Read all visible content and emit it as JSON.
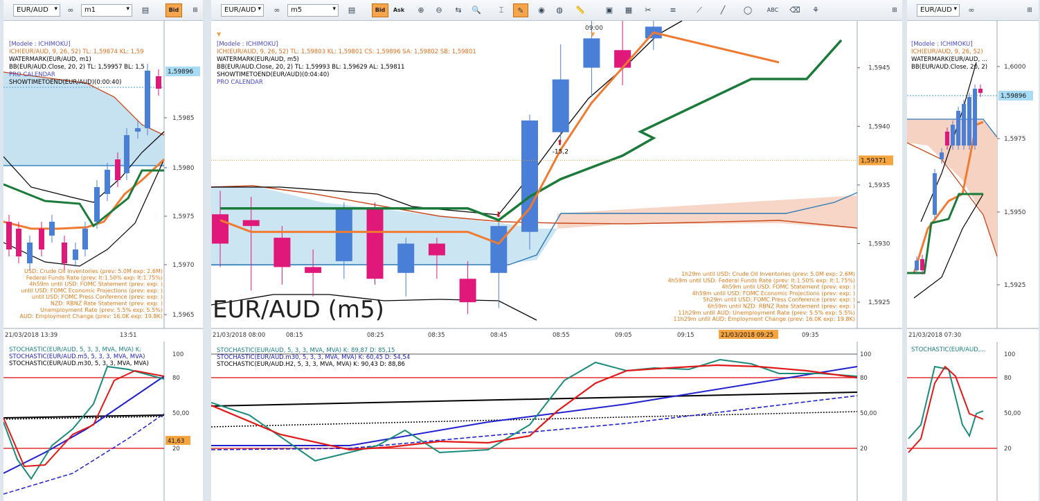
{
  "left": {
    "symbol": "EUR/AUD",
    "timeframe": "m1",
    "bid_label": "Bid",
    "legend": [
      {
        "text": "[Modele : ICHIMOKU]",
        "color": "#4848c8"
      },
      {
        "text": "ICH(EUR/AUD, 9, 26, 52)  TL: 1,59874  KL: 1,59",
        "color": "#e0701e"
      },
      {
        "text": "WATERMARK(EUR/AUD, m1)",
        "color": "#000000"
      },
      {
        "text": "BB(EUR/AUD.Close, 20, 2)  TL: 1,59957  BL: 1,5",
        "color": "#000000"
      },
      {
        "text": "PRO CALENDAR",
        "color": "#4848c8"
      },
      {
        "text": "SHOWTIMETOEND(EUR/AUD)(0:00:40)",
        "color": "#000000"
      }
    ],
    "price_badge": "1,59896",
    "y_ticks": [
      "1,5985",
      "1,5980",
      "1,5975",
      "1,5970",
      "1,5965"
    ],
    "x_ticks": [
      "21/03/2018 13:39",
      "13:51"
    ],
    "calendar": [
      "USD: Crude Oil Inventories (prev: 5.0M exp: 2.6M)",
      "Federal Funds Rate (prev: lt:1.50% exp: lt:1.75%)",
      "4h59m until USD: FOMC Statement (prev:  exp:  )",
      "until USD: FOMC Economic Projections (prev:  exp:  )",
      "until USD: FOMC Press Conference (prev:  exp:  )",
      "NZD: RBNZ Rate Statement (prev:  exp:  )",
      "Unemployment Rate (prev: 5.5% exp: 5.5%)",
      "AUD: Employment Change (prev: 16.0K exp: 19.8K)"
    ],
    "stoch_legend": [
      {
        "text": "STOCHASTIC(EUR/AUD, 5, 3, 3, MVA, MVA)  K:",
        "color": "#1a8080"
      },
      {
        "text": "STOCHASTIC(EUR/AUD.m5, 5, 3, 3, MVA, MVA)",
        "color": "#2020c0"
      },
      {
        "text": "STOCHASTIC(EUR/AUD.m30, 5, 3, 3, MVA, MVA)",
        "color": "#000000"
      }
    ],
    "stoch_ticks": [
      "100",
      "80",
      "50,00",
      "20"
    ],
    "stoch_badge": "41,63"
  },
  "center": {
    "symbol": "EUR/AUD",
    "timeframe": "m5",
    "bid_label": "Bid",
    "ask_label": "Ask",
    "legend": [
      {
        "text": "[Modele : ICHIMOKU]",
        "color": "#4848c8"
      },
      {
        "text": "ICH(EUR/AUD, 9, 26, 52)  TL: 1,59803  KL: 1,59801  CS: 1,59896  SA: 1,59802  SB: 1,59801",
        "color": "#e0701e"
      },
      {
        "text": "WATERMARK(EUR/AUD, m5)",
        "color": "#000000"
      },
      {
        "text": "BB(EUR/AUD.Close, 20, 2)  TL: 1,59993  BL: 1,59629  AL: 1,59811",
        "color": "#000000"
      },
      {
        "text": "SHOWTIMETOEND(EUR/AUD)(0:04:40)",
        "color": "#000000"
      },
      {
        "text": "PRO CALENDAR",
        "color": "#4848c8"
      }
    ],
    "watermark": "EUR/AUD (m5)",
    "top_time": "09:00",
    "price_badge": "1,59371",
    "y_ticks": [
      "1,5945",
      "1,5940",
      "1,5935",
      "1,5930",
      "1,5925"
    ],
    "x_ticks": [
      "21/03/2018 08:00",
      "08:15",
      "08:25",
      "08:35",
      "08:45",
      "08:55",
      "09:05",
      "09:15",
      "09:35"
    ],
    "x_badge": "21/03/2018 09:25",
    "signal_label": "-15,2",
    "calendar": [
      "1h29m until USD: Crude Oil Inventories (prev: 5.0M exp: 2.6M)",
      "4h59m until USD: Federal Funds Rate (prev: lt:1.50% exp: lt:1.75%)",
      "4h59m until USD: FOMC Statement (prev:  exp:  )",
      "4h59m until USD: FOMC Economic Projections (prev:  exp:  )",
      "5h29m until USD: FOMC Press Conference (prev:  exp:  )",
      "6h59m until NZD: RBNZ Rate Statement (prev:  exp:  )",
      "11h29m until AUD: Unemployment Rate (prev: 5.5% exp: 5.5%)",
      "11h29m until AUD: Employment Change (prev: 16.0K exp: 19.8K)"
    ],
    "stoch_legend": [
      {
        "text": "STOCHASTIC(EUR/AUD, 5, 3, 3, MVA, MVA)  K: 89,87  D: 85,15",
        "color": "#1a8080"
      },
      {
        "text": "STOCHASTIC(EUR/AUD.m30, 5, 3, 3, MVA, MVA)  K: 60,45  D: 54,54",
        "color": "#2020c0"
      },
      {
        "text": "STOCHASTIC(EUR/AUD.H2, 5, 3, 3, MVA, MVA)  K: 90,43  D: 88,86",
        "color": "#000000"
      }
    ],
    "stoch_ticks": [
      "100",
      "80",
      "50,00",
      "20"
    ]
  },
  "right": {
    "symbol": "EUR/AUD",
    "legend": [
      {
        "text": "[Modele : ICHIMOKU]",
        "color": "#4848c8"
      },
      {
        "text": "ICH(EUR/AUD, 9, 26, 52)",
        "color": "#e0701e"
      },
      {
        "text": "WATERMARK(EUR/AUD, ...",
        "color": "#000000"
      },
      {
        "text": "BB(EUR/AUD.Close, 20, 2)",
        "color": "#000000"
      }
    ],
    "price_badge": "1,59896",
    "y_ticks": [
      "1,6000",
      "1,5975",
      "1,5950",
      "1,5925"
    ],
    "x_ticks": [
      "21/03/2018 07:30"
    ],
    "stoch_legend": [
      {
        "text": "STOCHASTIC(EUR/AUD,...",
        "color": "#1a8080"
      }
    ],
    "stoch_ticks": [
      "100",
      "80",
      "50,00",
      "20"
    ]
  },
  "chart_data": [
    {
      "type": "candlestick",
      "title": "EUR/AUD (m5)",
      "x": [
        "08:00",
        "08:05",
        "08:10",
        "08:15",
        "08:20",
        "08:25",
        "08:30",
        "08:35",
        "08:40",
        "08:45",
        "08:50",
        "08:55",
        "09:00",
        "09:05",
        "09:10"
      ],
      "open": [
        1.59325,
        1.5932,
        1.59305,
        1.5928,
        1.59285,
        1.5933,
        1.59275,
        1.593,
        1.5927,
        1.59275,
        1.5931,
        1.59395,
        1.5945,
        1.59465,
        1.59475
      ],
      "close": [
        1.593,
        1.59315,
        1.5928,
        1.59275,
        1.5933,
        1.5927,
        1.593,
        1.5929,
        1.5925,
        1.59315,
        1.59405,
        1.5944,
        1.59475,
        1.5945,
        1.59485
      ],
      "high": [
        1.59345,
        1.5934,
        1.59315,
        1.59295,
        1.59335,
        1.59335,
        1.59305,
        1.59305,
        1.59285,
        1.5932,
        1.5941,
        1.5947,
        1.5949,
        1.5949,
        1.59495
      ],
      "low": [
        1.5928,
        1.5926,
        1.59265,
        1.59255,
        1.5927,
        1.59265,
        1.59255,
        1.5927,
        1.5924,
        1.59245,
        1.59295,
        1.59385,
        1.59425,
        1.59435,
        1.59465
      ],
      "ylim": [
        1.5923,
        1.5949
      ],
      "series": [
        {
          "name": "Kijun",
          "color": "#1a7a3a",
          "values": [
            1.5933,
            1.5933,
            1.5933,
            1.5933,
            1.5933,
            1.5933,
            1.5933,
            1.5933,
            1.5933,
            1.5932,
            1.5934,
            1.59355,
            1.59365,
            1.59375,
            1.5939
          ]
        },
        {
          "name": "Tenkan",
          "color": "#f07a30",
          "values": [
            1.5932,
            1.5931,
            1.5931,
            1.5931,
            1.5931,
            1.5931,
            1.5931,
            1.5931,
            1.5931,
            1.593,
            1.5933,
            1.5938,
            1.5942,
            1.5945,
            1.5948
          ]
        }
      ]
    }
  ]
}
